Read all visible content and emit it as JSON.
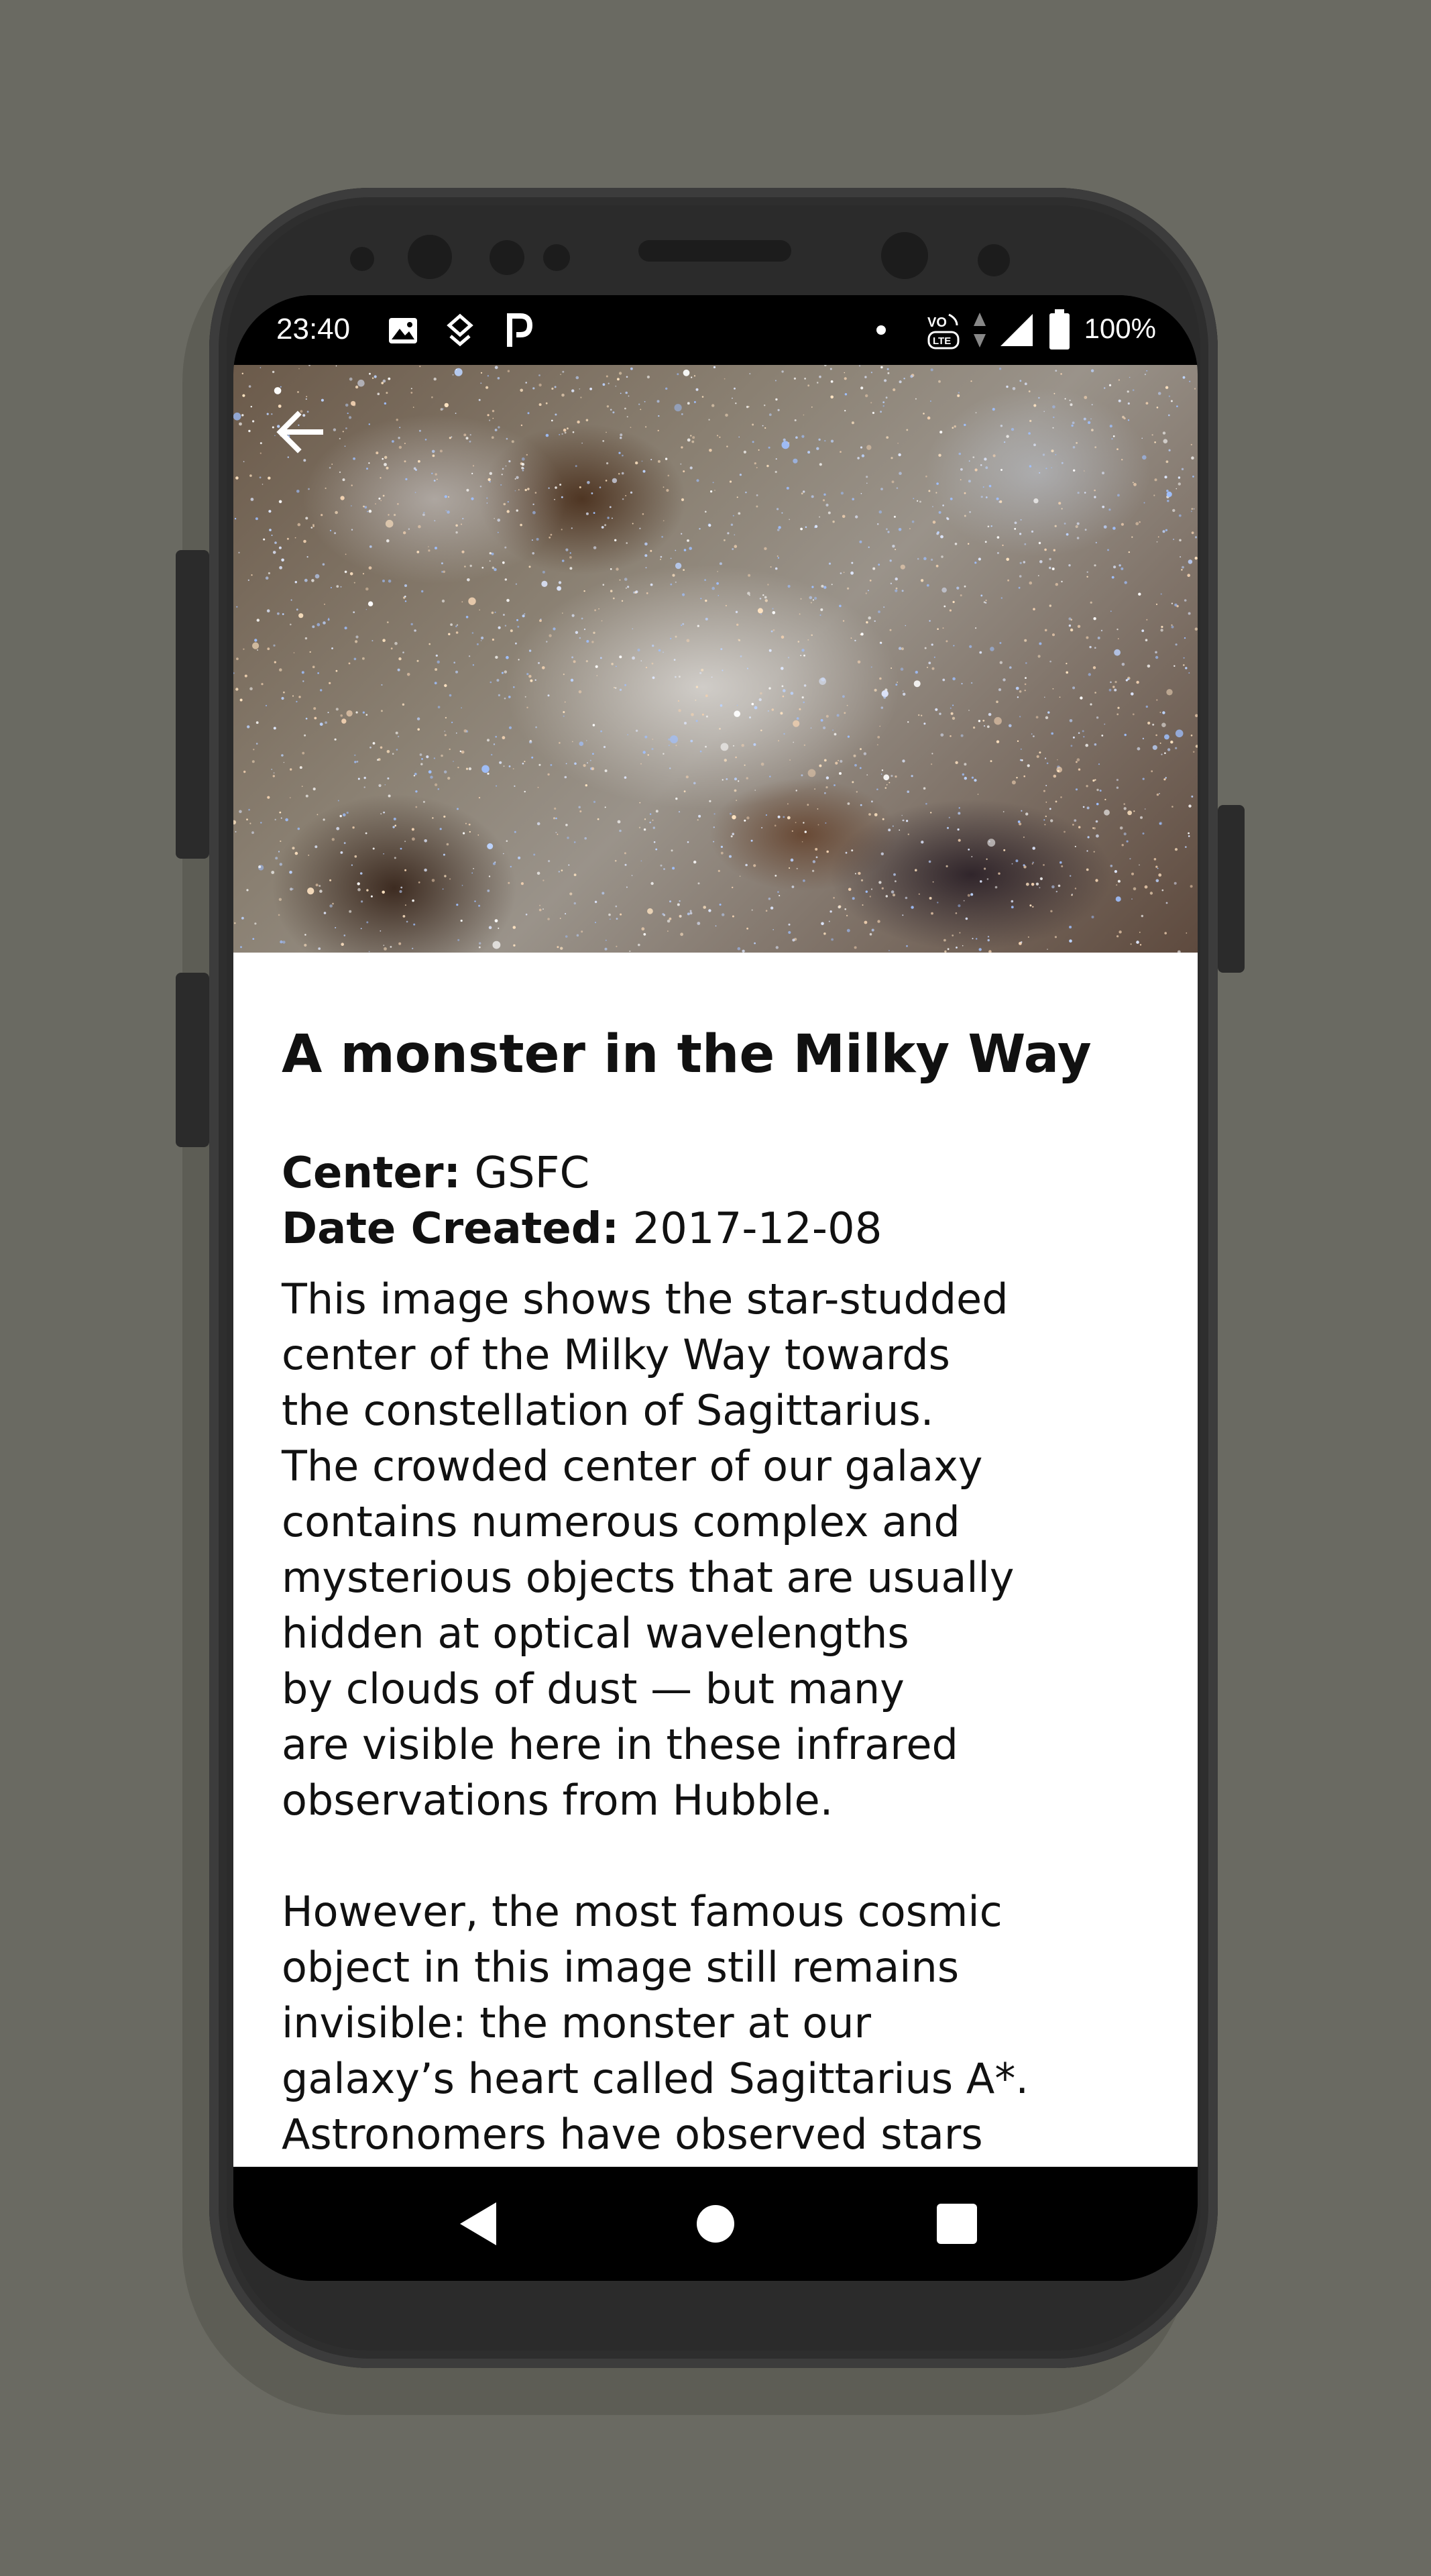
{
  "status_bar": {
    "time": "23:40",
    "notification_icons": [
      "image-icon",
      "shield-location-icon",
      "parking-icon"
    ],
    "system_icons": [
      "dot-icon",
      "volte-icon",
      "data-arrows-icon",
      "signal-icon",
      "battery-icon"
    ],
    "battery_percent": "100%"
  },
  "toolbar": {
    "back_icon": "arrow-back-icon"
  },
  "article": {
    "title": "A monster in the Milky Way",
    "center_label": "Center:",
    "center_value": "GSFC",
    "date_label": "Date Created:",
    "date_value": "2017-12-08",
    "description_lines": [
      "This image shows the star-studded",
      "center of the Milky Way towards",
      "the constellation of Sagittarius.",
      "The crowded center of our galaxy",
      "contains numerous complex and",
      "mysterious objects that are usually",
      "hidden at optical wavelengths",
      "by clouds of dust — but many",
      "are visible here in these infrared",
      "observations from Hubble."
    ],
    "description_lines_2": [
      "However, the most famous cosmic",
      "object in this image still remains",
      "invisible: the monster at our",
      "galaxy’s heart called Sagittarius A*.",
      "Astronomers have observed stars"
    ]
  },
  "nav_bar": {
    "back": "nav-back-icon",
    "home": "nav-home-icon",
    "recents": "nav-recents-icon"
  },
  "colors": {
    "background": "#6a6a62",
    "phone_frame": "#2b2b2b",
    "text": "#111111",
    "status_bar": "#000000"
  }
}
